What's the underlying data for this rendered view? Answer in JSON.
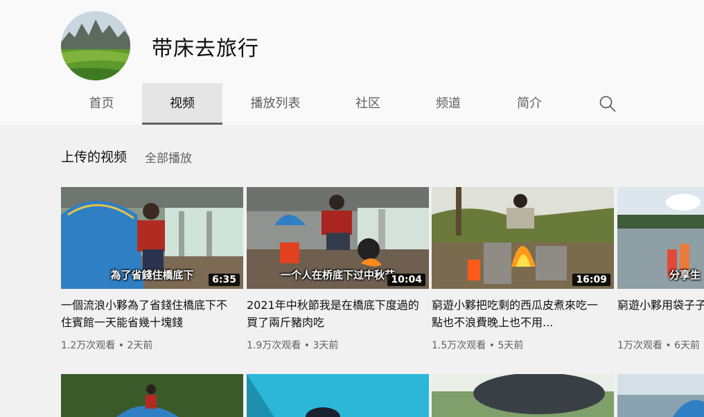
{
  "channel": {
    "name": "带床去旅行"
  },
  "tabs": [
    {
      "label": "首页"
    },
    {
      "label": "视频"
    },
    {
      "label": "播放列表"
    },
    {
      "label": "社区"
    },
    {
      "label": "频道"
    },
    {
      "label": "简介"
    }
  ],
  "active_tab": "视频",
  "section": {
    "title": "上传的视频",
    "play_all": "全部播放"
  },
  "videos": [
    {
      "title": "一個流浪小夥為了省錢住橋底下不住賓館一天能省幾十塊錢",
      "duration": "6:35",
      "overlay": "為了省錢住橋底下",
      "views": "1.2万次观看",
      "age": "2天前"
    },
    {
      "title": "2021年中秋節我是在橋底下度過的買了兩斤豬肉吃",
      "duration": "10:04",
      "overlay": "一个人在桥底下过中秋节",
      "views": "1.9万次观看",
      "age": "3天前"
    },
    {
      "title": "窮遊小夥把吃剩的西瓜皮煮來吃一點也不浪費晚上也不用...",
      "duration": "16:09",
      "overlay": "",
      "views": "1.5万次观看",
      "age": "5天前"
    },
    {
      "title": "窮遊小夥用袋子子替代盆節省空",
      "duration": "",
      "overlay": "分享生",
      "views": "1万次观看",
      "age": "6天前"
    }
  ],
  "separator": "•",
  "icons": {
    "search": "search-icon"
  }
}
